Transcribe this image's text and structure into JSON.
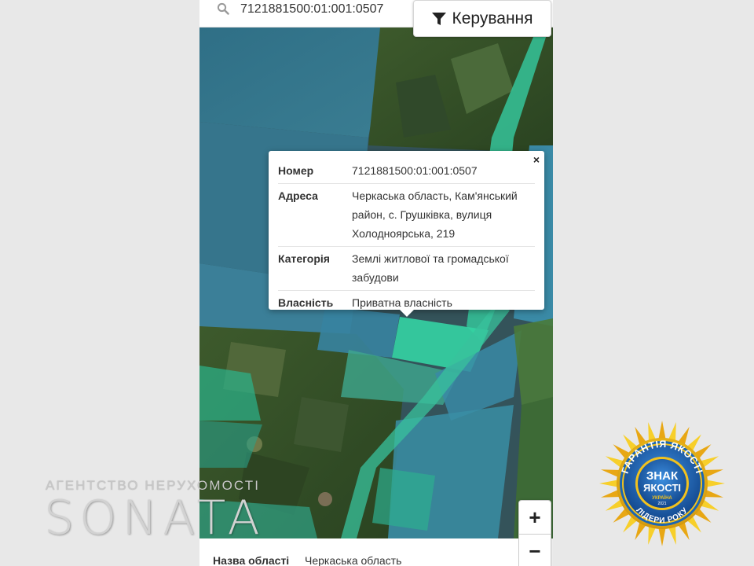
{
  "search": {
    "value": "7121881500:01:001:0507"
  },
  "controls": {
    "label": "Керування"
  },
  "popup": {
    "close": "×",
    "rows": [
      {
        "key": "Номер",
        "value": "7121881500:01:001:0507"
      },
      {
        "key": "Адреса",
        "value": "Черкаська область, Кам'янський район, с. Грушківка, вулиця Холодноярська, 219"
      },
      {
        "key": "Категорія",
        "value": "Землі житлової та громадської забудови"
      },
      {
        "key": "Власність",
        "value": "Приватна власність"
      }
    ]
  },
  "zoom": {
    "in": "+",
    "out": "−"
  },
  "bottom_info": {
    "key": "Назва області",
    "value": "Черкаська область"
  },
  "branding": {
    "tagline": "АГЕНТСТВО НЕРУХОМОСТІ",
    "name": "SONATA"
  },
  "seal": {
    "top_text": "ГАРАНТІЯ ЯКОСТІ",
    "center_line1": "ЗНАК",
    "center_line2": "ЯКОСТІ",
    "country": "УКРАЇНА",
    "year": "2021",
    "bottom_text": "ЛІДЕРИ РОКУ"
  },
  "colors": {
    "parcel_overlay": "#2bb3a0",
    "selected_parcel": "#34d3a3",
    "seal_gold": "#f2b819",
    "seal_blue": "#1b66b3"
  }
}
